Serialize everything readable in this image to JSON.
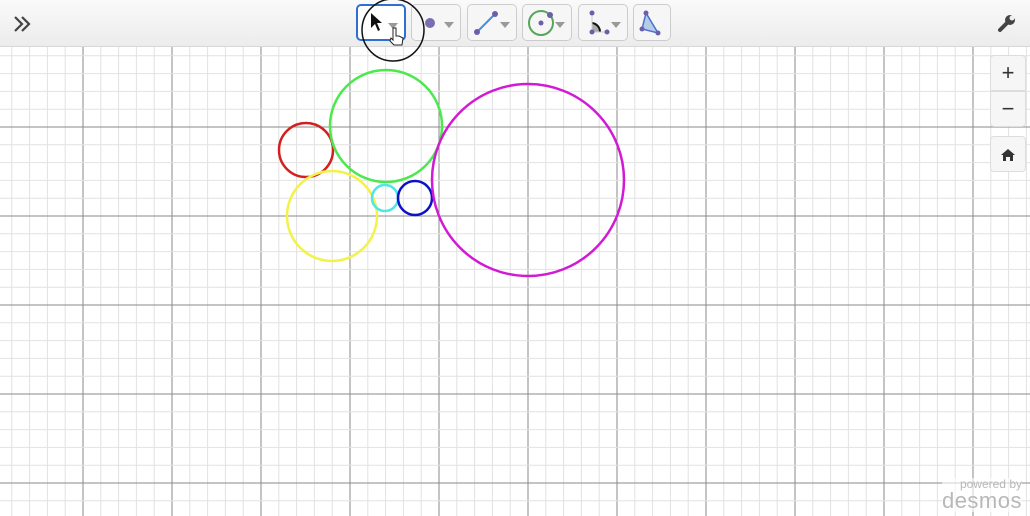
{
  "toolbar": {
    "expand_icon": "double-chevron-right-icon",
    "settings_icon": "wrench-icon",
    "tools": [
      {
        "name": "select",
        "icon": "arrow-pointer-icon",
        "selected": true
      },
      {
        "name": "point",
        "icon": "point-icon",
        "selected": false
      },
      {
        "name": "segment",
        "icon": "segment-icon",
        "selected": false
      },
      {
        "name": "circle",
        "icon": "circle-icon",
        "selected": false
      },
      {
        "name": "angle",
        "icon": "angle-icon",
        "selected": false
      },
      {
        "name": "polygon",
        "icon": "polygon-icon",
        "selected": false
      }
    ]
  },
  "zoom_controls": {
    "zoom_in": "+",
    "zoom_out": "−",
    "home_icon": "home-icon"
  },
  "branding": {
    "powered_by": "powered by",
    "logo": "desmos"
  },
  "circles": [
    {
      "color": "#d41f1f"
    },
    {
      "color": "#4de84d"
    },
    {
      "color": "#f2f24a"
    },
    {
      "color": "#4fe6e6"
    },
    {
      "color": "#1010c8"
    },
    {
      "color": "#d21ad6"
    }
  ]
}
